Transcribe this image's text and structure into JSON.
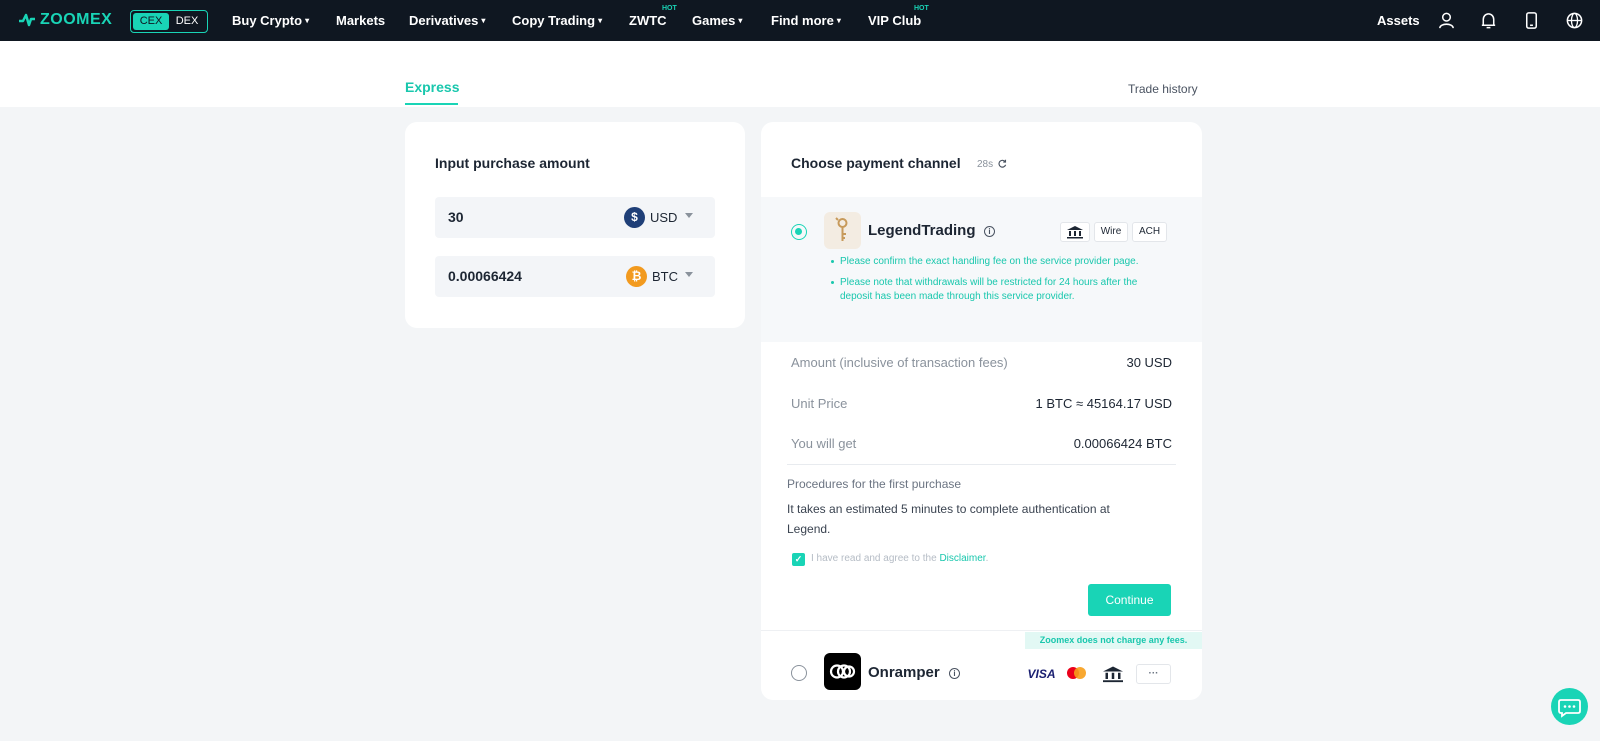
{
  "nav": {
    "logo": "ZOOMEX",
    "switch": {
      "cex": "CEX",
      "dex": "DEX"
    },
    "items": [
      {
        "label": "Buy Crypto",
        "caret": "▾"
      },
      {
        "label": "Markets"
      },
      {
        "label": "Derivatives",
        "caret": "▾"
      },
      {
        "label": "Copy Trading",
        "caret": "▾"
      },
      {
        "label": "ZWTC",
        "badge": "HOT"
      },
      {
        "label": "Games",
        "caret": "▾"
      },
      {
        "label": "Find more",
        "caret": "▾"
      },
      {
        "label": "VIP Club",
        "badge": "HOT"
      }
    ],
    "assets": "Assets",
    "icons": [
      "user-icon",
      "bell-icon",
      "phone-icon",
      "globe-icon"
    ]
  },
  "tabs": {
    "express": "Express",
    "trade_history": "Trade history"
  },
  "purchase": {
    "title": "Input purchase amount",
    "fiat": {
      "value": "30",
      "currency": "USD",
      "icon_text": "$"
    },
    "crypto": {
      "value": "0.00066424",
      "currency": "BTC",
      "icon_text": "₿"
    }
  },
  "payment": {
    "title": "Choose payment channel",
    "timer": "28s",
    "selected_provider": {
      "name": "LegendTrading",
      "tags": [
        "Wire",
        "ACH"
      ],
      "notes": [
        "Please confirm the exact handling fee on the service provider page.",
        "Please note that withdrawals will be restricted for 24 hours after the deposit has been made through this service provider."
      ]
    },
    "details": [
      {
        "label": "Amount (inclusive of transaction fees)",
        "value": "30 USD"
      },
      {
        "label": "Unit Price",
        "value": "1 BTC ≈ 45164.17 USD"
      },
      {
        "label": "You will get",
        "value": "0.00066424 BTC"
      }
    ],
    "procedures_title": "Procedures for the first purchase",
    "procedures_text": "It takes an estimated 5 minutes to complete authentication at Legend.",
    "agree_text": "I have read and agree to the ",
    "agree_link": "Disclaimer",
    "agree_end": ".",
    "continue": "Continue",
    "fee_banner": "Zoomex does not charge any fees.",
    "other_provider": {
      "name": "Onramper",
      "visa": "VISA",
      "more": "···"
    }
  },
  "colors": {
    "accent": "#19d4b6",
    "nav_bg": "#0f1721",
    "page_bg": "#f3f5f7"
  }
}
